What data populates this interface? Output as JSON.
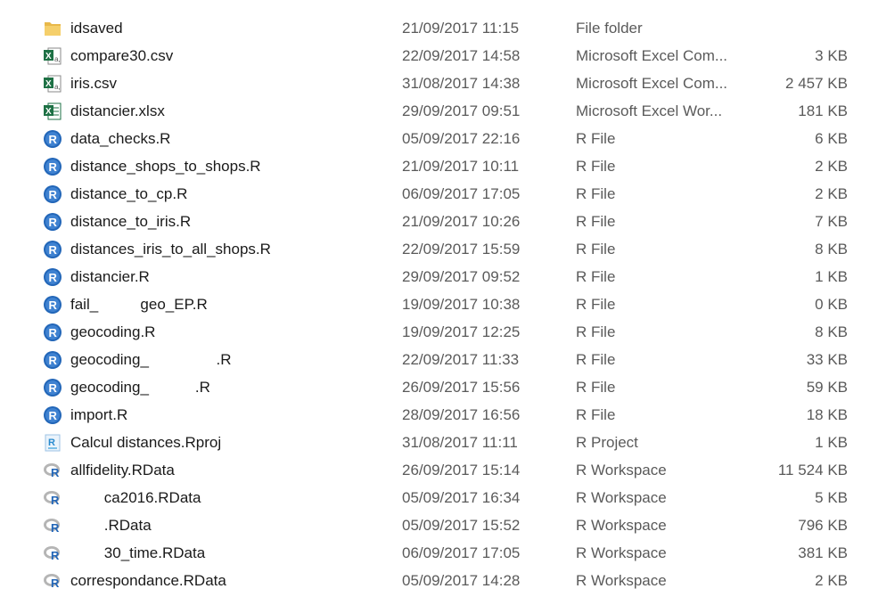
{
  "files": [
    {
      "icon": "folder-icon",
      "name": "idsaved",
      "date": "21/09/2017 11:15",
      "type": "File folder",
      "size": ""
    },
    {
      "icon": "excel-csv-icon",
      "name": "compare30.csv",
      "date": "22/09/2017 14:58",
      "type": "Microsoft Excel Com...",
      "size": "3 KB"
    },
    {
      "icon": "excel-csv-icon",
      "name": "iris.csv",
      "date": "31/08/2017 14:38",
      "type": "Microsoft Excel Com...",
      "size": "2 457 KB"
    },
    {
      "icon": "excel-workbook-icon",
      "name": "distancier.xlsx",
      "date": "29/09/2017 09:51",
      "type": "Microsoft Excel Wor...",
      "size": "181 KB"
    },
    {
      "icon": "r-file-icon",
      "name": "data_checks.R",
      "date": "05/09/2017 22:16",
      "type": "R File",
      "size": "6 KB"
    },
    {
      "icon": "r-file-icon",
      "name": "distance_shops_to_shops.R",
      "date": "21/09/2017 10:11",
      "type": "R File",
      "size": "2 KB"
    },
    {
      "icon": "r-file-icon",
      "name": "distance_to_cp.R",
      "date": "06/09/2017 17:05",
      "type": "R File",
      "size": "2 KB"
    },
    {
      "icon": "r-file-icon",
      "name": "distance_to_iris.R",
      "date": "21/09/2017 10:26",
      "type": "R File",
      "size": "7 KB"
    },
    {
      "icon": "r-file-icon",
      "name": "distances_iris_to_all_shops.R",
      "date": "22/09/2017 15:59",
      "type": "R File",
      "size": "8 KB"
    },
    {
      "icon": "r-file-icon",
      "name": "distancier.R",
      "date": "29/09/2017 09:52",
      "type": "R File",
      "size": "1 KB"
    },
    {
      "icon": "r-file-icon",
      "name": "fail_          geo_EP.R",
      "date": "19/09/2017 10:38",
      "type": "R File",
      "size": "0 KB"
    },
    {
      "icon": "r-file-icon",
      "name": "geocoding.R",
      "date": "19/09/2017 12:25",
      "type": "R File",
      "size": "8 KB"
    },
    {
      "icon": "r-file-icon",
      "name": "geocoding_                .R",
      "date": "22/09/2017 11:33",
      "type": "R File",
      "size": "33 KB"
    },
    {
      "icon": "r-file-icon",
      "name": "geocoding_           .R",
      "date": "26/09/2017 15:56",
      "type": "R File",
      "size": "59 KB"
    },
    {
      "icon": "r-file-icon",
      "name": "import.R",
      "date": "28/09/2017 16:56",
      "type": "R File",
      "size": "18 KB"
    },
    {
      "icon": "r-project-icon",
      "name": "Calcul distances.Rproj",
      "date": "31/08/2017 11:11",
      "type": "R Project",
      "size": "1 KB"
    },
    {
      "icon": "r-workspace-icon",
      "name": "allfidelity.RData",
      "date": "26/09/2017 15:14",
      "type": "R Workspace",
      "size": "11 524 KB"
    },
    {
      "icon": "r-workspace-icon",
      "name": "        ca2016.RData",
      "date": "05/09/2017 16:34",
      "type": "R Workspace",
      "size": "5 KB"
    },
    {
      "icon": "r-workspace-icon",
      "name": "        .RData",
      "date": "05/09/2017 15:52",
      "type": "R Workspace",
      "size": "796 KB"
    },
    {
      "icon": "r-workspace-icon",
      "name": "        30_time.RData",
      "date": "06/09/2017 17:05",
      "type": "R Workspace",
      "size": "381 KB"
    },
    {
      "icon": "r-workspace-icon",
      "name": "correspondance.RData",
      "date": "05/09/2017 14:28",
      "type": "R Workspace",
      "size": "2 KB"
    }
  ],
  "colors": {
    "folder": "#e8b84a",
    "excel_green": "#1e7145",
    "r_blue": "#2266b8",
    "r_gray": "#9a9a9a",
    "meta_text": "#5a5a5a"
  }
}
